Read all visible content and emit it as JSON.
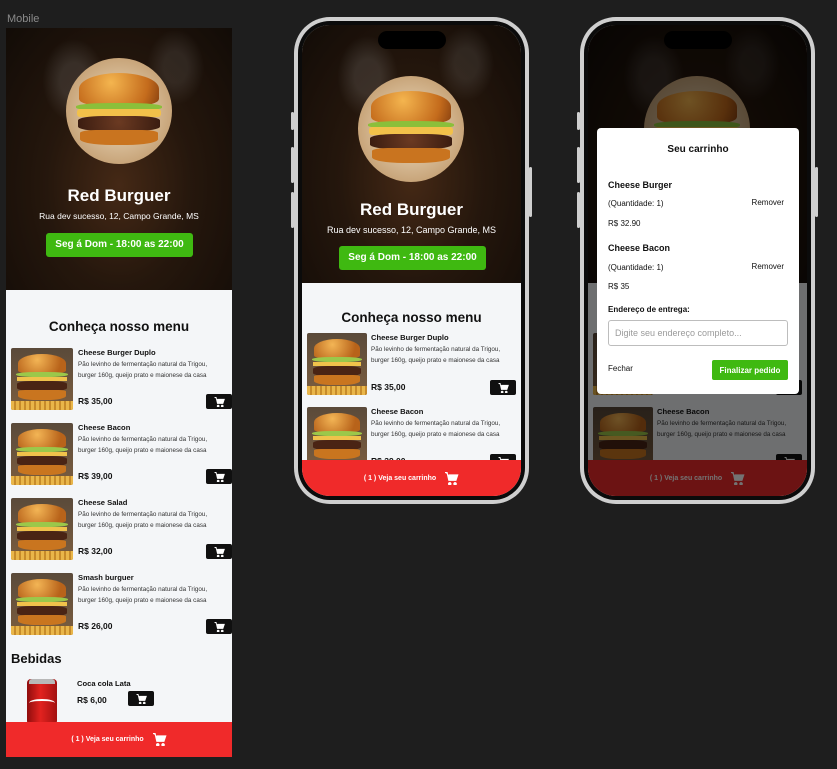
{
  "canvas": {
    "label": "Mobile"
  },
  "restaurant": {
    "name": "Red Burguer",
    "address": "Rua dev sucesso, 12, Campo Grande, MS",
    "hours": "Seg á Dom - 18:00 as 22:00"
  },
  "menu": {
    "heading": "Conheça nosso menu",
    "items": [
      {
        "name": "Cheese Burger Duplo",
        "desc": "Pão levinho de fermentação natural da Trigou, burger 160g, queijo prato e maionese da casa",
        "price": "R$ 35,00"
      },
      {
        "name": "Cheese Bacon",
        "desc": "Pão levinho de fermentação natural da Trigou, burger 160g, queijo prato e maionese da casa",
        "price": "R$ 39,00"
      },
      {
        "name": "Cheese Salad",
        "desc": "Pão levinho de fermentação natural da Trigou, burger 160g, queijo prato e maionese da casa",
        "price": "R$ 32,00"
      },
      {
        "name": "Smash burguer",
        "desc": "Pão levinho de fermentação natural da Trigou, burger 160g, queijo prato e maionese da casa",
        "price": "R$ 26,00"
      }
    ],
    "drinks_heading": "Bebidas",
    "drinks": [
      {
        "name": "Coca cola Lata",
        "price": "R$ 6,00"
      }
    ]
  },
  "cart_bar": {
    "label": "( 1 ) Veja seu carrinho"
  },
  "modal": {
    "title": "Seu carrinho",
    "items": [
      {
        "name": "Cheese Burger",
        "qty": "(Quantidade: 1)",
        "remove": "Remover",
        "price": "R$ 32.90"
      },
      {
        "name": "Cheese Bacon",
        "qty": "(Quantidade: 1)",
        "remove": "Remover",
        "price": "R$ 35"
      }
    ],
    "address_label": "Endereço de entrega:",
    "address_placeholder": "Digite seu endereço completo...",
    "close_label": "Fechar",
    "finish_label": "Finalizar pedido"
  },
  "icons": {
    "cart": "cart-icon"
  },
  "colors": {
    "accent_red": "#f02a2a",
    "accent_green": "#3fb911",
    "dark": "#101010"
  }
}
